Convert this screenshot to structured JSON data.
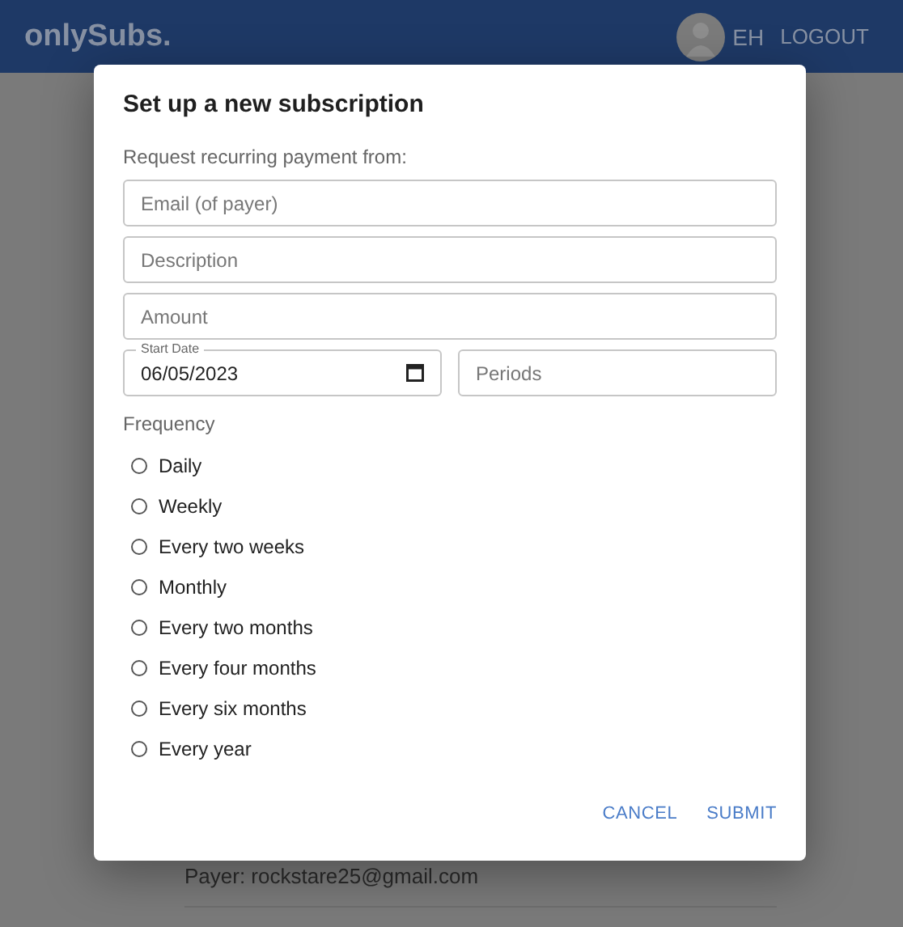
{
  "header": {
    "logo": "onlySubs.",
    "user_initials": "EH",
    "logout": "LOGOUT"
  },
  "background": {
    "payer_text": "Payer: rockstare25@gmail.com"
  },
  "dialog": {
    "title": "Set up a new subscription",
    "subtitle": "Request recurring payment from:",
    "fields": [
      {
        "placeholder": "Email (of payer)"
      },
      {
        "placeholder": "Description"
      },
      {
        "placeholder": "Amount"
      }
    ],
    "start_date": {
      "label": "Start Date",
      "value": "06/05/2023"
    },
    "periods": {
      "placeholder": "Periods"
    },
    "frequency_label": "Frequency",
    "frequency_options": [
      {
        "label": "Daily",
        "selected": false
      },
      {
        "label": "Weekly",
        "selected": false
      },
      {
        "label": "Every two weeks",
        "selected": false
      },
      {
        "label": "Monthly",
        "selected": false
      },
      {
        "label": "Every two months",
        "selected": false
      },
      {
        "label": "Every four months",
        "selected": false
      },
      {
        "label": "Every six months",
        "selected": false
      },
      {
        "label": "Every year",
        "selected": false
      }
    ],
    "buttons": [
      "CANCEL",
      "SUBMIT"
    ]
  }
}
